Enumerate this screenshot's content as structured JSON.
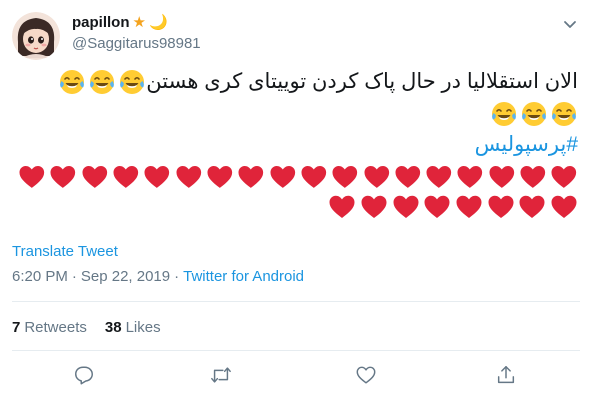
{
  "user": {
    "display_name": "papillon",
    "badges": [
      "★",
      "🌙"
    ],
    "handle": "@Saggitarus98981",
    "avatar_icon": "cartoon-girl-avatar"
  },
  "tweet": {
    "text": "الان استقلالیا در حال پاک کردن توییتای کری هستن",
    "hashtag": "#پرسپولیس",
    "emoji_row1_count": 3,
    "emoji_row2_count": 3,
    "hearts_row1": 18,
    "hearts_row2": 8
  },
  "translate_label": "Translate Tweet",
  "meta": {
    "time": "6:20 PM",
    "separator1": "·",
    "date": "Sep 22, 2019",
    "separator2": "·",
    "source": "Twitter for Android"
  },
  "stats": {
    "retweets_count": "7",
    "retweets_label": "Retweets",
    "likes_count": "38",
    "likes_label": "Likes"
  },
  "icons": {
    "reply": "reply-icon",
    "retweet": "retweet-icon",
    "like": "like-icon",
    "share": "share-icon",
    "caret": "chevron-down-icon"
  },
  "colors": {
    "link": "#1b95e0",
    "secondary": "#657786",
    "heart": "#e0243a",
    "divider": "#e6ecf0"
  }
}
